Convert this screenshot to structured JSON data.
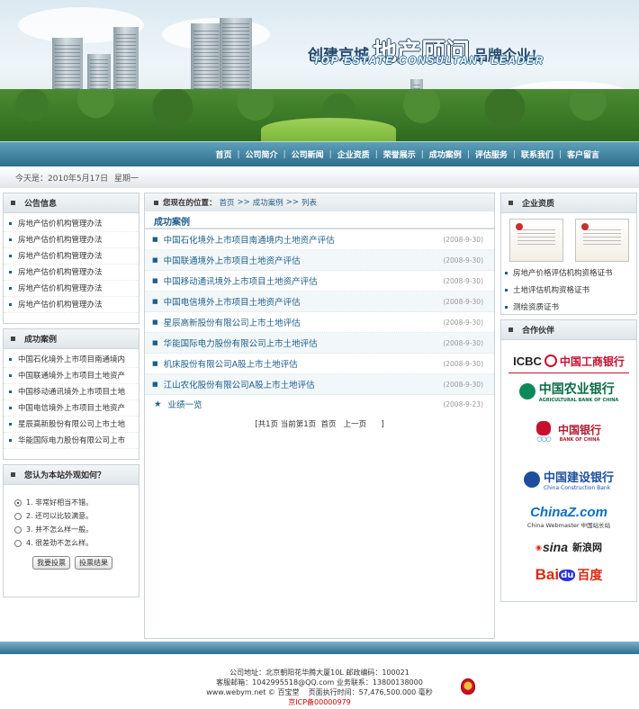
{
  "banner": {
    "slogan_part1": "创建京城",
    "slogan_part2": "地产顾问",
    "slogan_part3": "品牌企业!",
    "slogan_en": "TOP ESTATE CONSULTANT LEADER"
  },
  "nav": {
    "items": [
      "首页",
      "公司简介",
      "公司新闻",
      "企业资质",
      "荣誉展示",
      "成功案例",
      "评估服务",
      "联系我们",
      "客户留言"
    ],
    "separator": "|"
  },
  "datebar": {
    "prefix": "今天是：",
    "date": "2010年5月17日",
    "weekday": "星期一"
  },
  "notice": {
    "title": "公告信息",
    "items": [
      "房地产估价机构管理办法",
      "房地产估价机构管理办法",
      "房地产估价机构管理办法",
      "房地产估价机构管理办法",
      "房地产估价机构管理办法",
      "房地产估价机构管理办法"
    ]
  },
  "cases_left": {
    "title": "成功案例",
    "items": [
      "中国石化境外上市项目南通境内",
      "中国联通境外上市项目土地资产",
      "中国移动通讯境外上市项目土地",
      "中国电信境外上市项目土地资产",
      "星辰高新股份有限公司上市土地",
      "华能国际电力股份有限公司上市"
    ]
  },
  "vote": {
    "title": "您认为本站外观如何？",
    "options": [
      "1. 非常好相当不错。",
      "2. 还可以比较满意。",
      "3. 并不怎么样一般。",
      "4. 很差劲不怎么样。"
    ],
    "selected_index": 0,
    "vote_button": "我要投票",
    "result_button": "投票结果"
  },
  "main": {
    "crumb_label": "您现在的位置：",
    "crumb": [
      "首页",
      "成功案例",
      "列表"
    ],
    "crumb_sep": ">>",
    "section_title": "成功案例",
    "articles": [
      {
        "title": "中国石化境外上市项目南通境内土地资产评估",
        "date": "(2008-9-30)"
      },
      {
        "title": "中国联通境外上市项目土地资产评估",
        "date": "(2008-9-30)"
      },
      {
        "title": "中国移动通讯境外上市项目土地资产评估",
        "date": "(2008-9-30)"
      },
      {
        "title": "中国电信境外上市项目土地资产评估",
        "date": "(2008-9-30)"
      },
      {
        "title": "星辰高新股份有限公司上市土地评估",
        "date": "(2008-9-30)"
      },
      {
        "title": "华能国际电力股份有限公司上市土地评估",
        "date": "(2008-9-30)"
      },
      {
        "title": "机床股份有限公司A股上市土地评估",
        "date": "(2008-9-30)"
      },
      {
        "title": "江山农化股份有限公司A股上市土地评估",
        "date": "(2008-9-30)"
      }
    ],
    "extra": {
      "star": "★",
      "title": "业绩一览",
      "date": "(2008-9-23)"
    },
    "pager": {
      "info": "[共1页 当前第1页",
      "first": "首页",
      "prev": "上一页",
      "close": "]"
    }
  },
  "qualification": {
    "title": "企业资质",
    "items": [
      "房地产价格评估机构资格证书",
      "土地评估机构资格证书",
      "测绘资质证书"
    ]
  },
  "partners": {
    "title": "合作伙伴",
    "icbc_en": "ICBC",
    "icbc_cn": "中国工商银行",
    "abc_cn": "中国农业银行",
    "abc_en": "AGRICULTURAL BANK OF CHINA",
    "boc_cn": "中国银行",
    "boc_en": "BANK OF CHINA",
    "ccb_cn": "中国建设银行",
    "ccb_en": "China Construction Bank",
    "chinaz": "ChinaZ.com",
    "chinaz_sub": "China Webmaster 中国站长站",
    "sina_en": "sina",
    "sina_cn": "新浪网",
    "baidu_en": "Bai",
    "baidu_du": "du",
    "baidu_cn": "百度"
  },
  "footer": {
    "line1": "公司地址：北京朝阳花华腾大厦10L  邮政编码：100021",
    "line2": "客服邮箱：1042995518@QQ.com  业务联系：13800138000",
    "line3_left": "www.webym.net © 百宝堂",
    "line3_right": "页面执行时间：57,476,500.000 毫秒",
    "icp": "京ICP备00000979"
  },
  "colors": {
    "nav": "#2c6e8c",
    "link": "#1e5f8a",
    "accent_red": "#c00000"
  }
}
